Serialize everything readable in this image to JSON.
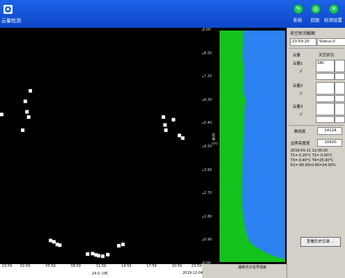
{
  "app": {
    "title": "云量检测"
  },
  "toolbar": [
    {
      "label": "系统",
      "glyph": "✎"
    },
    {
      "label": "回放",
      "glyph": "◎"
    },
    {
      "label": "检测设置",
      "glyph": "✕"
    }
  ],
  "colors": {
    "topbar": "#1452d9",
    "accent_green": "#1cc95a",
    "bar_green": "#12c31e",
    "bar_blue": "#2b82f0"
  },
  "chart_data": {
    "type": "scatter",
    "xlabel": "24.0 小时",
    "date": "2019-12-04",
    "x_ticks": [
      "23:59",
      "02:59",
      "05:59",
      "08:59",
      "11:59",
      "14:59",
      "17:59",
      "20:59",
      "23:59"
    ],
    "y_ticks": [
      "0.00",
      "-8.00",
      "-7.20",
      "-6.30",
      "-5.40",
      "-4.50",
      "-3.60",
      "-2.70",
      "-1.80",
      "-0.90",
      "0.00"
    ],
    "ylabel": "星等(m)",
    "xlim": [
      0,
      24
    ],
    "ylim": [
      -9,
      0
    ],
    "points": [
      [
        0.2,
        -5.7
      ],
      [
        3.0,
        -6.2
      ],
      [
        3.6,
        -6.6
      ],
      [
        3.2,
        -5.8
      ],
      [
        3.4,
        -5.6
      ],
      [
        2.7,
        -5.1
      ],
      [
        6.0,
        -0.9
      ],
      [
        6.4,
        -0.85
      ],
      [
        6.8,
        -0.75
      ],
      [
        7.1,
        -0.72
      ],
      [
        10.4,
        -0.38
      ],
      [
        11.0,
        -0.4
      ],
      [
        11.4,
        -0.35
      ],
      [
        11.7,
        -0.32
      ],
      [
        12.2,
        -0.3
      ],
      [
        12.8,
        -0.36
      ],
      [
        14.1,
        -0.7
      ],
      [
        14.6,
        -0.75
      ],
      [
        19.4,
        -5.6
      ],
      [
        19.6,
        -5.3
      ],
      [
        19.7,
        -5.1
      ],
      [
        20.6,
        -5.5
      ],
      [
        21.3,
        -4.9
      ],
      [
        21.7,
        -4.8
      ]
    ],
    "side_bar_label": "最新光子信号强度"
  },
  "panel": {
    "title": "天空状况报图",
    "time": "23:59:20",
    "status": "Status:0",
    "col_header_a": "云量",
    "col_header_b": "天空状况",
    "rows": [
      {
        "name": "云量1",
        "code": "//",
        "value": "SRC"
      },
      {
        "name": "云量2",
        "code": "//",
        "value": ""
      },
      {
        "name": "云量3",
        "code": "//",
        "value": ""
      }
    ],
    "brightness_label": "数码度",
    "brightness_value": "14124",
    "boundary_label": "边界亮度度",
    "boundary_value": "10420",
    "readouts": [
      "2019-01-11    12:00:20",
      "T1= 0.20°C  T2= 0.00°C",
      "T3= 0.40°C  T4=25.00°C",
      "R1=-90.00ml  R0=24.00%"
    ],
    "history_button": "查看历史记录 ..."
  }
}
